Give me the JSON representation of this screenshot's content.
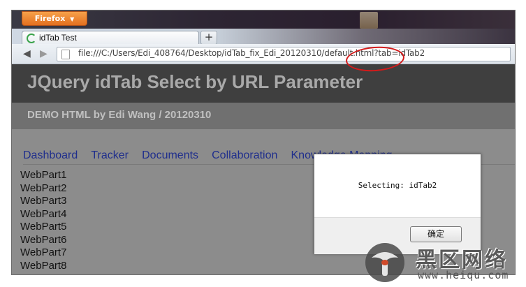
{
  "browser": {
    "app_button_label": "Firefox",
    "tab_title": "idTab Test",
    "new_tab_label": "+",
    "url": "file:///C:/Users/Edi_408764/Desktop/idTab_fix_Edi_20120310/default.html?tab=idTab2"
  },
  "page": {
    "title": "JQuery idTab Select by URL Parameter",
    "subtitle": "DEMO HTML by Edi Wang / 20120310",
    "tabs": [
      "Dashboard",
      "Tracker",
      "Documents",
      "Collaboration",
      "Knowledge Mapping"
    ],
    "webparts": [
      "WebPart1",
      "WebPart2",
      "WebPart3",
      "WebPart4",
      "WebPart5",
      "WebPart6",
      "WebPart7",
      "WebPart8"
    ]
  },
  "dialog": {
    "message": "Selecting: idTab2",
    "ok_label": "确定"
  },
  "watermark": {
    "cn_text": "黑区网络",
    "url": "www.heiqu.com"
  },
  "colors": {
    "annotation_circle": "#d51a1a",
    "firefox_orange": "#e4701f",
    "tab_link": "#1f2e8c"
  }
}
